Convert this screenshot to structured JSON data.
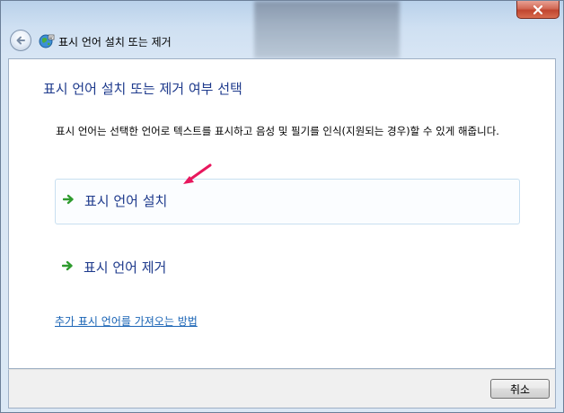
{
  "window": {
    "title": "표시 언어 설치 또는 제거"
  },
  "main": {
    "heading": "표시 언어 설치 또는 제거 여부 선택",
    "description": "표시 언어는 선택한 언어로 텍스트를 표시하고 음성 및 필기를 인식(지원되는 경우)할 수 있게 해줍니다.",
    "options": [
      {
        "label": "표시 언어 설치",
        "icon": "green-arrow-icon"
      },
      {
        "label": "표시 언어 제거",
        "icon": "green-arrow-icon"
      }
    ],
    "help_link": "추가 표시 언어를 가져오는 방법"
  },
  "footer": {
    "cancel_label": "취소"
  },
  "colors": {
    "heading": "#1e3a8c",
    "link": "#1a64b5",
    "arrow_annotation": "#e8175d",
    "close_button": "#c0452f"
  }
}
